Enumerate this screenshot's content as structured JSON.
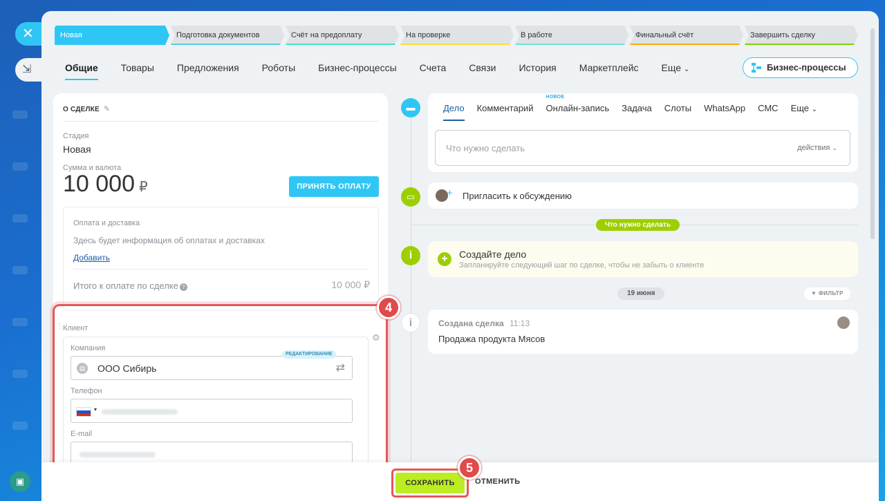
{
  "rail": {
    "close_glyph": "✕",
    "tab_glyph": "⇲",
    "bottom_glyph": "▣"
  },
  "stages": [
    {
      "label": "Новая",
      "bg": "#2fc6f6",
      "bar": "#2fc6f6",
      "color": "#ffffff"
    },
    {
      "label": "Подготовка документов",
      "bg": "#dfe3e6",
      "bar": "#55d0e0",
      "color": "#333333"
    },
    {
      "label": "Счёт на предоплату",
      "bg": "#dfe3e6",
      "bar": "#47e4c2",
      "color": "#333333"
    },
    {
      "label": "На проверке",
      "bg": "#dfe3e6",
      "bar": "#ffdd33",
      "color": "#333333"
    },
    {
      "label": "В работе",
      "bg": "#dfe3e6",
      "bar": "#6ee2d8",
      "color": "#333333"
    },
    {
      "label": "Финальный счёт",
      "bg": "#dfe3e6",
      "bar": "#ffa900",
      "color": "#333333"
    },
    {
      "label": "Завершить сделку",
      "bg": "#dfe3e6",
      "bar": "#7bd500",
      "color": "#333333"
    }
  ],
  "tabs": [
    "Общие",
    "Товары",
    "Предложения",
    "Роботы",
    "Бизнес-процессы",
    "Счета",
    "Связи",
    "История",
    "Маркетплейс",
    "Еще"
  ],
  "bp_button": "Бизнес-процессы",
  "deal": {
    "title": "О СДЕЛКЕ",
    "stage_label": "Стадия",
    "stage_value": "Новая",
    "sum_label": "Сумма и валюта",
    "amount": "10 000",
    "currency": "₽",
    "pay_button": "ПРИНЯТЬ ОПЛАТУ",
    "payment_title": "Оплата и доставка",
    "payment_hint": "Здесь будет информация об оплатах и доставках",
    "add_link": "Добавить",
    "total_label": "Итого к оплате по сделке",
    "total_value": "10 000 ₽"
  },
  "client": {
    "section_label": "Клиент",
    "company_label": "Компания",
    "edit_badge": "РЕДАКТИРОВАНИЕ",
    "company_value": "ООО Сибирь",
    "phone_label": "Телефон",
    "email_label": "E-mail"
  },
  "steps": {
    "client": "4",
    "save": "5"
  },
  "activity": {
    "tabs": [
      "Дело",
      "Комментарий",
      "Онлайн-запись",
      "Задача",
      "Слоты",
      "WhatsApp",
      "СМС",
      "Еще"
    ],
    "new_badge": "НОВОЕ",
    "todo_placeholder": "Что нужно сделать",
    "actions_label": "действия"
  },
  "timeline": {
    "invite": "Пригласить к обсуждению",
    "todo_pill": "Что нужно сделать",
    "create_title": "Создайте дело",
    "create_hint": "Запланируйте следующий шаг по сделке, чтобы не забыть о клиенте",
    "date_pill": "19 июня",
    "filter": "ФИЛЬТР",
    "event_title": "Создана сделка",
    "event_time": "11:13",
    "event_text": "Продажа продукта Мясов"
  },
  "footer": {
    "save": "СОХРАНИТЬ",
    "cancel": "ОТМЕНИТЬ"
  }
}
